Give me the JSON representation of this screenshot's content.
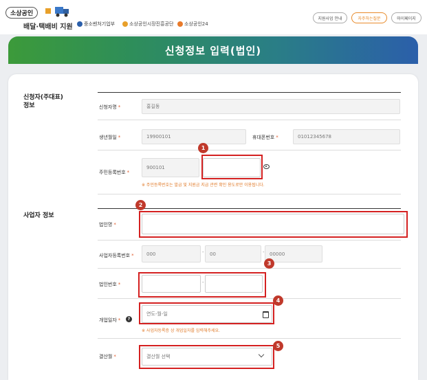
{
  "header": {
    "logo_tag": "소상공인",
    "brand_title": "배달·택배비 지원",
    "org1": "중소벤처기업부",
    "org2": "소상공인시장진흥공단",
    "org3": "소상공인24",
    "buttons": [
      "지원사업 안내",
      "자주하는질문",
      "마이페이지"
    ]
  },
  "banner_title": "신청정보 입력(법인)",
  "sections": {
    "applicant": "신청자(주대표)\n정보",
    "business": "사업자 정보"
  },
  "fields": {
    "name_label": "신청자명",
    "name_value": "홍길동",
    "birth_label": "생년월일",
    "birth_value": "19900101",
    "phone_label": "휴대폰번호",
    "phone_value": "01012345678",
    "rrn_label": "주민등록번호",
    "rrn_front": "900101",
    "rrn_note": "※ 주민등록번호는 발급 및 지원금 지급 관련 확인 용도로만 이용됩니다.",
    "corp_name_label": "법인명",
    "bizno_label": "사업자등록번호",
    "bizno_1": "000",
    "bizno_2": "00",
    "bizno_3": "00000",
    "corp_no_label": "법인번호",
    "open_date_label": "개업일자",
    "open_date_placeholder": "연도-월-일",
    "open_date_note": "※ 사업자등록증 상 개업일자를 입력해주세요.",
    "settle_label": "결산월",
    "settle_placeholder": "결산월 선택"
  },
  "markers": [
    "1",
    "2",
    "3",
    "4",
    "5"
  ],
  "colors": {
    "marker": "#c0392b",
    "required": "#e05a2a",
    "banner_start": "#3c9a3a",
    "banner_end": "#2b5faa"
  }
}
